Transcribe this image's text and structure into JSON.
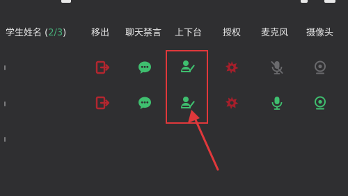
{
  "header": {
    "student_name_label": "学生姓名",
    "count_open": "(",
    "count_value": "2/3",
    "count_close": ")",
    "columns": {
      "move_out": "移出",
      "chat_ban": "聊天禁言",
      "stage": "上下台",
      "authorize": "授权",
      "microphone": "麦克风",
      "camera": "摄像头"
    }
  },
  "rows": [
    {
      "move_out_icon": "exit-icon",
      "chat_icon": "chat-bubble-icon",
      "stage_icon": "podium-user-icon",
      "auth_icon": "authorize-icon",
      "mic_icon": "microphone-off-icon",
      "camera_icon": "camera-off-icon",
      "mic_state": "off",
      "camera_state": "off"
    },
    {
      "move_out_icon": "exit-icon",
      "chat_icon": "chat-bubble-icon",
      "stage_icon": "podium-user-icon",
      "auth_icon": "authorize-icon",
      "mic_icon": "microphone-icon",
      "camera_icon": "camera-icon",
      "mic_state": "on",
      "camera_state": "on"
    }
  ],
  "colors": {
    "background": "#2f2f31",
    "header_text": "#e6e6e6",
    "count_accent": "#47b27b",
    "move_out": "#b3262f",
    "chat": "#3fbf6f",
    "stage": "#3fbf6f",
    "authorize": "#a51f2b",
    "device_off": "#6a6a6d",
    "device_on": "#3fbf6f",
    "annotation": "#e0383b"
  }
}
